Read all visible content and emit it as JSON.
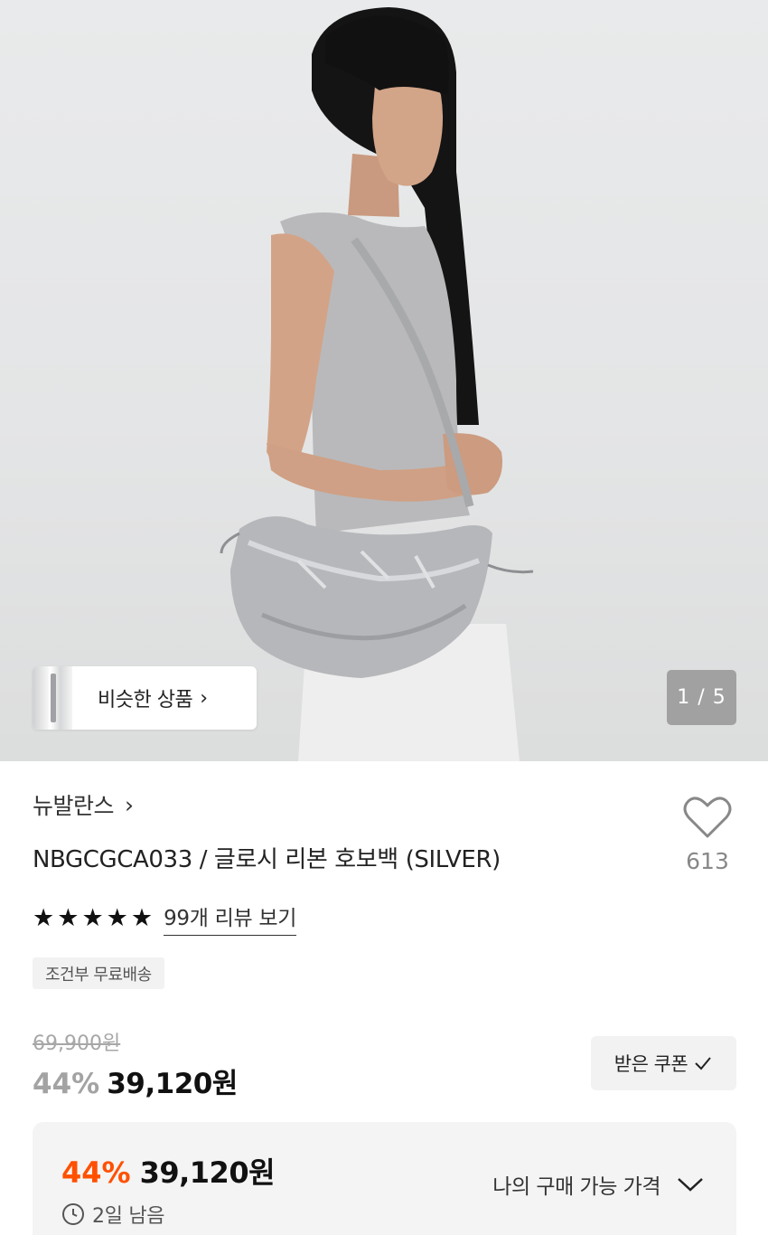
{
  "gallery": {
    "similar_label": "비슷한 상품",
    "counter": "1 / 5"
  },
  "product": {
    "brand": "뉴발란스",
    "title": "NBGCGCA033 / 글로시 리본 호보백 (SILVER)",
    "like_count": "613",
    "rating": 5,
    "review_link": "99개 리뷰 보기",
    "shipping_badge": "조건부 무료배송"
  },
  "price": {
    "original": "69,900원",
    "discount": "44%",
    "sale": "39,120원",
    "coupon_label": "받은 쿠폰"
  },
  "my_price": {
    "discount": "44%",
    "amount": "39,120원",
    "label": "나의 구매 가능 가격",
    "remaining": "2일 남음"
  },
  "colors": {
    "accent": "#ff5000",
    "badge_bg": "#f2f2f2"
  },
  "icons": {
    "star": "★",
    "chevron_right": "›",
    "heart": "heart-icon",
    "clock": "clock-icon",
    "chevron_down": "chevron-down-icon",
    "check": "check-icon"
  }
}
